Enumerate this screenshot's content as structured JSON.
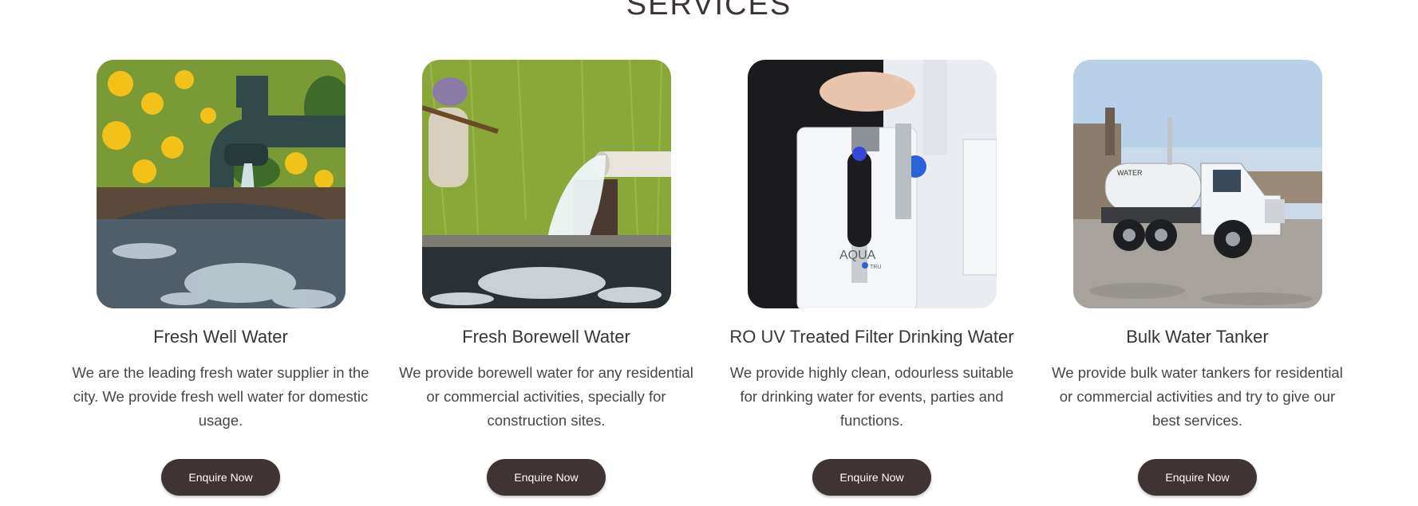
{
  "section": {
    "title": "SERVICES"
  },
  "services": [
    {
      "title": "Fresh Well Water",
      "description": "We are the leading fresh water supplier in the city. We provide fresh well water for domestic usage.",
      "button_label": "Enquire Now"
    },
    {
      "title": "Fresh Borewell Water",
      "description": "We provide borewell water for any residential or commercial activities, specially for construction sites.",
      "button_label": "Enquire Now"
    },
    {
      "title": "RO UV Treated Filter Drinking Water",
      "description": "We provide highly clean, odourless suitable for drinking water for events, parties and functions.",
      "button_label": "Enquire Now",
      "image_text": {
        "brand": "AQUA",
        "sub": "TRU"
      }
    },
    {
      "title": "Bulk Water Tanker",
      "description": "We provide bulk water tankers for residential or commercial activities and try to give our best services.",
      "button_label": "Enquire Now",
      "image_text": {
        "tank_label": "WATER"
      }
    }
  ],
  "colors": {
    "button_bg": "#3f3333",
    "button_text": "#ffffff",
    "heading": "#3d3535"
  }
}
